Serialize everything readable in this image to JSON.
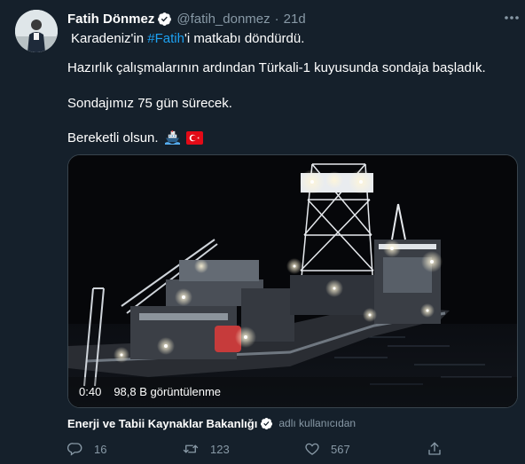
{
  "tweet": {
    "author_name": "Fatih Dönmez",
    "handle": "@fatih_donmez",
    "separator": "·",
    "time": "21d",
    "text": {
      "line1_pre": "Karadeniz'in ",
      "line1_hashtag": "#Fatih",
      "line1_post": "'i matkabı döndürdü.",
      "line2": "Hazırlık çalışmalarının ardından Türkali-1 kuyusunda sondaja başladık.",
      "line3": "Sondajımız 75 gün sürecek.",
      "line4": "Bereketli olsun."
    },
    "emojis": [
      "ship-emoji",
      "turkey-flag-emoji"
    ]
  },
  "media": {
    "duration": "0:40",
    "views": "98,8 B görüntülenme"
  },
  "source": {
    "name": "Enerji ve Tabii Kaynaklar Bakanlığı",
    "note": "adlı kullanıcıdan"
  },
  "actions": {
    "reply_count": "16",
    "retweet_count": "123",
    "like_count": "567"
  },
  "colors": {
    "background": "#15202b",
    "accent": "#1da1f2",
    "muted": "#8899a6"
  }
}
